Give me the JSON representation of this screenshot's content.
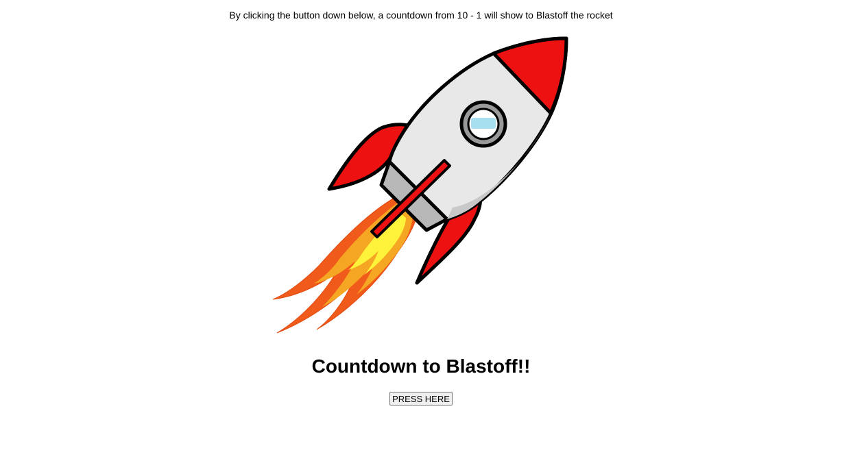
{
  "intro_text": "By clicking the button down below, a countdown from 10 - 1 will show to Blastoff the rocket",
  "rocket_image": {
    "icon": "rocket-icon",
    "colors": {
      "body": "#e8e8e8",
      "fins": "#ee1111",
      "nose": "#ee1111",
      "flame_outer": "#f05a1a",
      "flame_mid": "#f5a623",
      "flame_inner": "#fff23a",
      "window_glass": "#a8dff0",
      "outline": "#000000"
    }
  },
  "heading": "Countdown to Blastoff!!",
  "button": {
    "label": "PRESS HERE"
  }
}
